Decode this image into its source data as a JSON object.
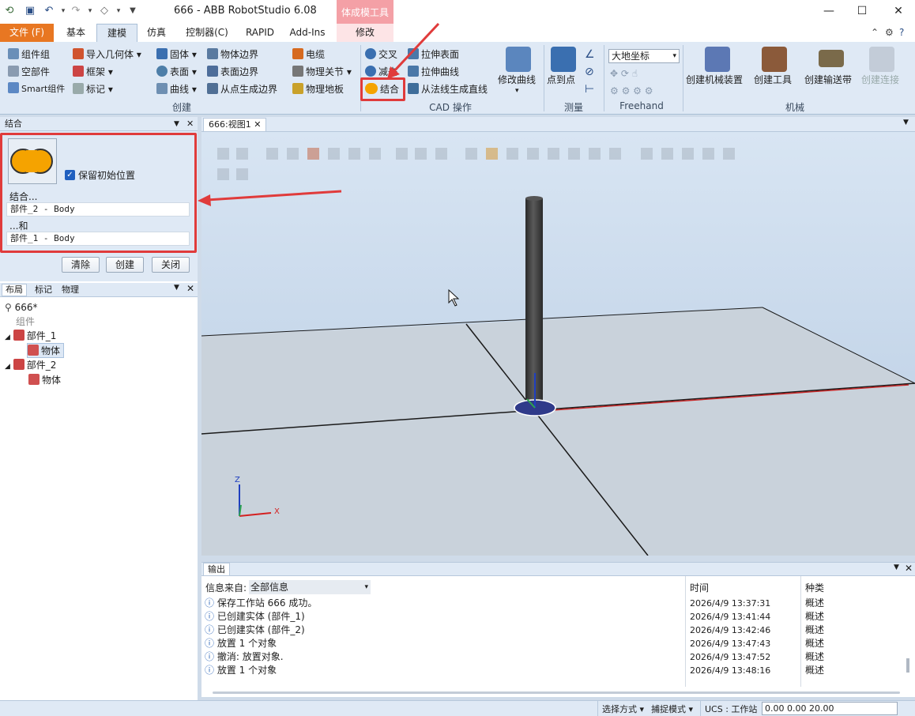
{
  "app": {
    "title": "666 - ABB RobotStudio 6.08",
    "context_tab_group": "体成模工具",
    "window": {
      "minimize": "—",
      "maximize": "☐",
      "close": "✕"
    }
  },
  "tabs": {
    "file": "文件 (F)",
    "basic": "基本",
    "model": "建模",
    "simulate": "仿真",
    "controller": "控制器(C)",
    "rapid": "RAPID",
    "addins": "Add-Ins",
    "modify": "修改"
  },
  "ribbon": {
    "create": {
      "label": "创建",
      "component_group": "组件组",
      "empty_part": "空部件",
      "smart_component": "Smart组件",
      "import_geometry": "导入几何体",
      "frame": "框架",
      "tag": "标记",
      "solid": "固体",
      "surface": "表面",
      "curve": "曲线",
      "body_border": "物体边界",
      "surface_border": "表面边界",
      "point_border": "从点生成边界",
      "cable": "电缆",
      "physics_joint": "物理关节",
      "physics_floor": "物理地板"
    },
    "cad": {
      "label": "CAD 操作",
      "intersect": "交叉",
      "subtract": "减去",
      "union": "结合",
      "extrude_surface": "拉伸表面",
      "extrude_curve": "拉伸曲线",
      "normal_line": "从法线生成直线",
      "modify_curve": "修改曲线"
    },
    "measure": {
      "label": "测量",
      "point_to_point": "点到点"
    },
    "freehand": {
      "label": "Freehand",
      "coord_select": "大地坐标"
    },
    "mechanism": {
      "label": "机械",
      "create_mechanism": "创建机械装置",
      "create_tool": "创建工具",
      "create_conveyor": "创建输送带",
      "create_connection": "创建连接"
    }
  },
  "combine_panel": {
    "title": "结合",
    "keep_position": "保留初始位置",
    "combine_label": "结合...",
    "field1": "部件_2 - Body",
    "and_label": "...和",
    "field2": "部件_1 - Body",
    "clear": "清除",
    "create": "创建",
    "close": "关闭"
  },
  "layout_panel": {
    "tabs": [
      "布局",
      "标记",
      "物理"
    ],
    "station": "666*",
    "group": "组件",
    "part1": "部件_1",
    "part1_body": "物体",
    "part2": "部件_2",
    "part2_body": "物体"
  },
  "view": {
    "tab": "666:视图1",
    "axis_x": "X",
    "axis_z": "Z"
  },
  "output": {
    "title": "输出",
    "filter_label": "信息来自:",
    "filter_value": "全部信息",
    "col_time": "时间",
    "col_type": "种类",
    "rows": [
      {
        "msg": "保存工作站 666 成功。",
        "time": "2026/4/9 13:37:31",
        "type": "概述"
      },
      {
        "msg": "已创建实体 (部件_1)",
        "time": "2026/4/9 13:41:44",
        "type": "概述"
      },
      {
        "msg": "已创建实体 (部件_2)",
        "time": "2026/4/9 13:42:46",
        "type": "概述"
      },
      {
        "msg": "放置 1 个对象",
        "time": "2026/4/9 13:47:43",
        "type": "概述"
      },
      {
        "msg": "撤消: 放置对象.",
        "time": "2026/4/9 13:47:52",
        "type": "概述"
      },
      {
        "msg": "放置 1 个对象",
        "time": "2026/4/9 13:48:16",
        "type": "概述"
      }
    ]
  },
  "status": {
    "select_mode": "选择方式",
    "snap_mode": "捕捉模式",
    "ucs": "UCS : 工作站",
    "coords": "0.00   0.00   20.00"
  },
  "colors": {
    "file_tab": "#e87722",
    "ribbon_bg": "#dfe9f5",
    "highlight": "#e03b3b",
    "union_icon": "#f5a300"
  }
}
